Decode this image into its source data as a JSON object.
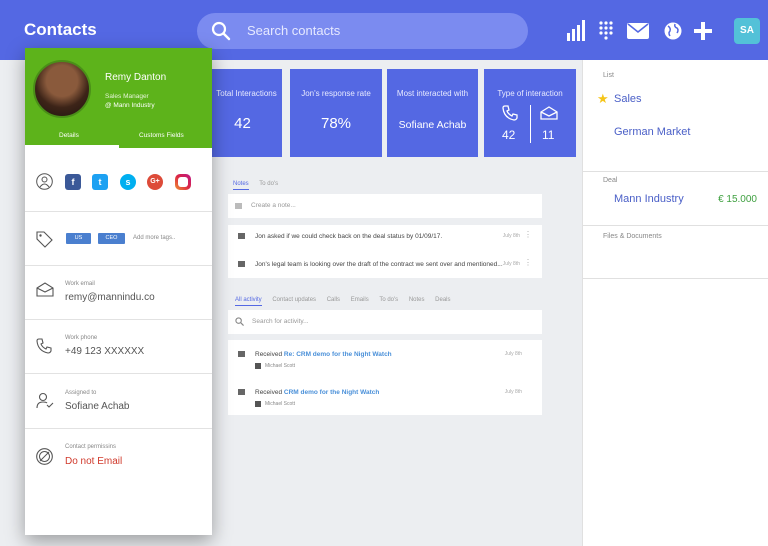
{
  "header": {
    "title": "Contacts",
    "search_placeholder": "Search contacts",
    "user_initials": "SA",
    "icons": [
      "search-icon",
      "bar-chart-icon",
      "dialpad-icon",
      "mail-icon",
      "globe-icon",
      "plus-icon"
    ]
  },
  "colors": {
    "brand": "#5468e3",
    "contact_green": "#5db31b",
    "amount_green": "#3fa040",
    "link_blue": "#4a5fc7"
  },
  "stats": [
    {
      "label": "Total Interactions",
      "value": "42"
    },
    {
      "label": "Jon's response rate",
      "value": "78%"
    },
    {
      "label": "Most interacted with",
      "value": "Sofiane Achab"
    },
    {
      "label": "Type of interaction",
      "calls": "42",
      "emails": "11"
    }
  ],
  "contact": {
    "name": "Remy Danton",
    "role": "Sales Manager",
    "company": "@ Mann Industry",
    "tabs": [
      "Details",
      "Customs Fields"
    ],
    "tags": [
      "US",
      "CEO"
    ],
    "add_tags": "Add more tags..",
    "work_email_label": "Work email",
    "work_email": "remy@mannindu.co",
    "work_phone_label": "Work phone",
    "work_phone": "+49 123 XXXXXX",
    "assigned_label": "Assigned to",
    "assigned": "Sofiane Achab",
    "permissions_label": "Contact permissins",
    "permissions": "Do not Email"
  },
  "notes": {
    "tabs": [
      "Notes",
      "To do's"
    ],
    "create_placeholder": "Create a note...",
    "items": [
      {
        "text": "Jon asked if we could check back on the deal status by 01/09/17.",
        "date": "July 8th"
      },
      {
        "text": "Jon's legal team is looking over the draft of the contract we sent over and mentioned...",
        "date": "July 8th"
      }
    ]
  },
  "activity": {
    "tabs": [
      "All activity",
      "Contact updates",
      "Calls",
      "Emails",
      "To do's",
      "Notes",
      "Deals"
    ],
    "search_placeholder": "Search for activity...",
    "items": [
      {
        "prefix": "Received",
        "subject": "Re: CRM demo for the Night Watch",
        "date": "July 8th",
        "user": "Michael Scott"
      },
      {
        "prefix": "Received",
        "subject": "CRM demo for the Night Watch",
        "date": "July 8th",
        "user": "Michael Scott"
      }
    ]
  },
  "side": {
    "list_label": "List",
    "lists": [
      "Sales",
      "German Market"
    ],
    "deal_label": "Deal",
    "deal_name": "Mann Industry",
    "deal_amount": "€ 15.000",
    "files_label": "Files & Documents"
  }
}
